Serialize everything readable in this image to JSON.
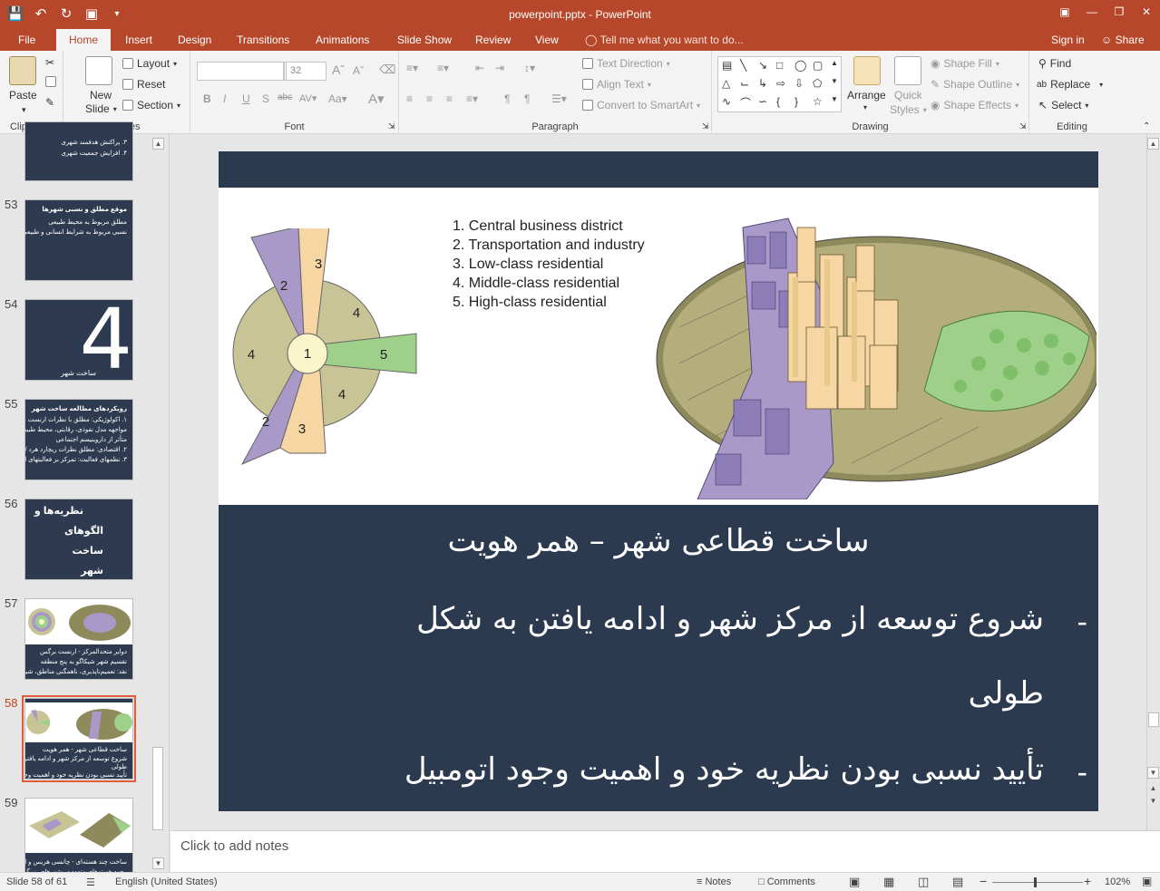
{
  "app": {
    "window_title": "powerpoint.pptx - PowerPoint",
    "accent": "#b7472a"
  },
  "qat": {
    "save_icon": "save-icon",
    "undo_icon": "undo-icon",
    "redo_icon": "repeat-icon",
    "present_icon": "present-icon",
    "customize_icon": "customize-icon"
  },
  "tabs": [
    "File",
    "Home",
    "Insert",
    "Design",
    "Transitions",
    "Animations",
    "Slide Show",
    "Review",
    "View"
  ],
  "active_tab": "Home",
  "tell_me": "Tell me what you want to do...",
  "account": {
    "sign_in": "Sign in",
    "share": "Share"
  },
  "ribbon": {
    "clipboard": {
      "label": "Clipboard",
      "paste": "Paste"
    },
    "slides": {
      "label": "Slides",
      "new_slide_line1": "New",
      "new_slide_line2": "Slide",
      "layout": "Layout",
      "reset": "Reset",
      "section": "Section"
    },
    "font": {
      "label": "Font",
      "font_name": "",
      "font_size": "32"
    },
    "paragraph": {
      "label": "Paragraph",
      "text_direction": "Text Direction",
      "align_text": "Align Text",
      "convert_smartart": "Convert to SmartArt"
    },
    "drawing": {
      "label": "Drawing",
      "arrange": "Arrange",
      "quick_styles_1": "Quick",
      "quick_styles_2": "Styles",
      "shape_fill": "Shape Fill",
      "shape_outline": "Shape Outline",
      "shape_effects": "Shape Effects"
    },
    "editing": {
      "label": "Editing",
      "find": "Find",
      "replace": "Replace",
      "select": "Select"
    }
  },
  "thumbnails": [
    {
      "num": "",
      "lines": [
        "۳. پراکنش هدفمند شهری",
        "۴. افزایش جمعیت شهری"
      ]
    },
    {
      "num": "53",
      "lines": [
        "موقع مطلق و نسبی شهرها",
        "مطلق مربوط به محیط طبیعی",
        "نسبی مربوط به شرایط انسانی و طبیعی پیرامونی"
      ]
    },
    {
      "num": "54",
      "big": "4",
      "lines": [
        "ساخت شهر"
      ]
    },
    {
      "num": "55",
      "lines": [
        "رویکردهای مطالعه ساخت شهر",
        "۱. اکولوژیکی: مطلق با نظرات ارنست برگس",
        "مواجهه مدل نفوذی، رقابتی، محیط طبیعی",
        "متأثر از داروینیسم اجتماعی",
        "۲. اقتصادی: مطلق نظرات ریچارد هرد / برژی مالتر",
        "۳. نظمهای فعالیت: تمرکز بر فعالیتهای انسانی"
      ]
    },
    {
      "num": "56",
      "lines": [
        "نظریه‌ها و",
        "الگوهای",
        "ساخت",
        "شهر"
      ]
    },
    {
      "num": "57",
      "lines": [
        "دوایر متحدالمرکز - ارنست برگس",
        "تقسیم شهر شیکاگو به پنج منطقه",
        "نقد: تعمیم‌ناپذیری، ناهمگنی مناطق، شیب تغییرات"
      ]
    },
    {
      "num": "58",
      "lines": [
        "ساخت قطاعی شهر - همر هویت",
        "شروع توسعه از مرکز شهر و ادامه یافتن به شکل",
        "طولی",
        "تأیید نسبی بودن نظریه خود و اهمیت وجود اتومبیل"
      ]
    },
    {
      "num": "59",
      "lines": [
        "ساخت چند هسته‌ای - چانسی هریس و ادوارد اولمن",
        "وجود هسته‌های متعدد در شهرهای بزرگ"
      ]
    }
  ],
  "selected_slide": "58",
  "slide": {
    "legend": [
      "1. Central business district",
      "2. Transportation and industry",
      "3. Low-class residential",
      "4. Middle-class residential",
      "5. High-class residential"
    ],
    "sector_labels": [
      "1",
      "2",
      "3",
      "4",
      "5",
      "4",
      "2",
      "3",
      "4"
    ],
    "title": "ساخت قطاعی شهر – همر هویت",
    "bullet_dash": "-",
    "bullets": [
      "شروع توسعه از مرکز شهر و ادامه یافتن به شکل",
      "طولی",
      "تأیید نسبی بودن نظریه خود و اهمیت وجود اتومبیل"
    ],
    "colors": {
      "purple": "#a999c8",
      "olive": "#c9c496",
      "peach": "#f6d7a3",
      "green": "#9fd08a",
      "cbd": "#fbf6c9",
      "bg": "#2c3a4f"
    }
  },
  "notes_placeholder": "Click to add notes",
  "status": {
    "slide_info": "Slide 58 of 61",
    "language": "English (United States)",
    "notes": "Notes",
    "comments": "Comments",
    "zoom": "102%"
  }
}
